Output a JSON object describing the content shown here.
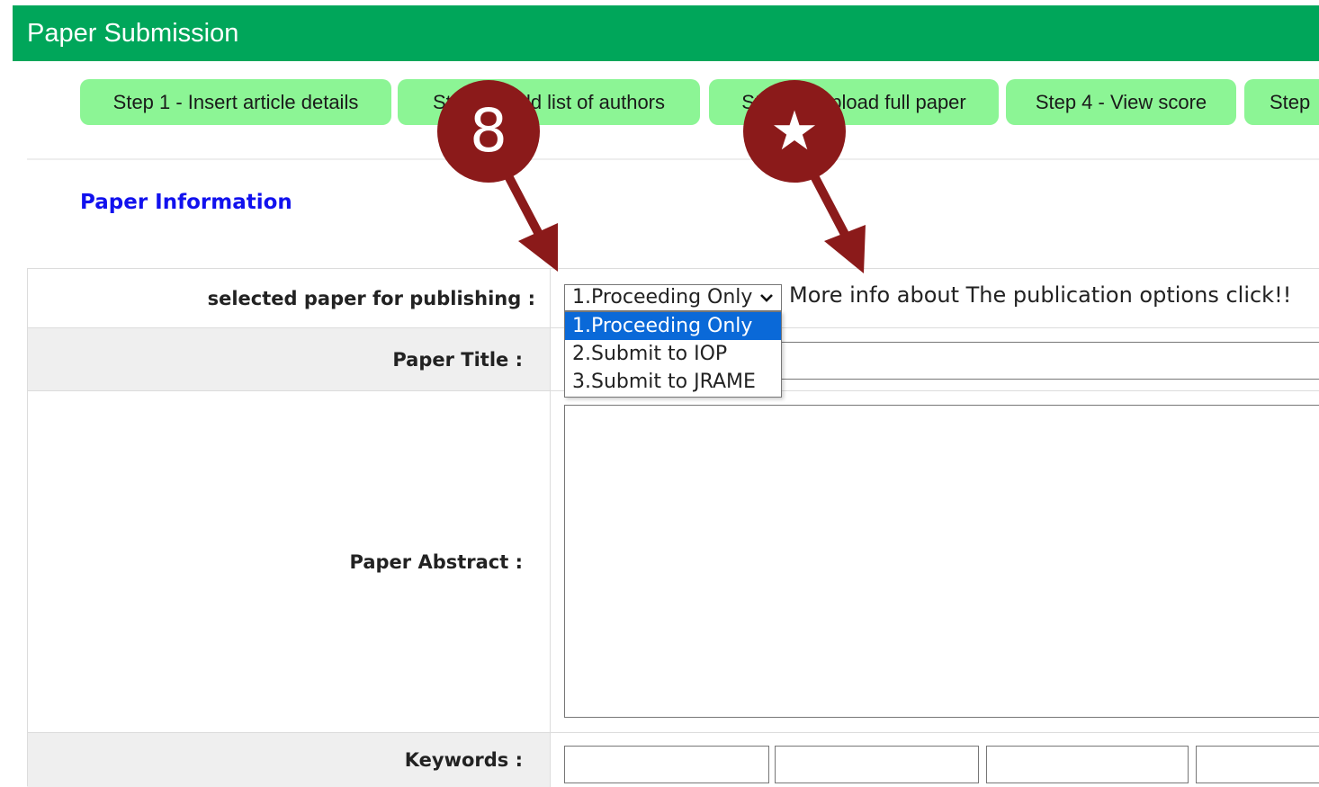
{
  "header": {
    "title": "Paper Submission"
  },
  "steps": [
    {
      "label": "Step 1 - Insert article details"
    },
    {
      "label": "Step 2 - Add list of authors"
    },
    {
      "label": "Step 3 - Upload full paper"
    },
    {
      "label": "Step 4 - View score"
    },
    {
      "label": "Step"
    }
  ],
  "section": {
    "title": "Paper Information"
  },
  "form": {
    "publishing_label": "selected paper for publishing :",
    "publishing_selected": "1.Proceeding Only",
    "publishing_options": [
      "1.Proceeding Only",
      "2.Submit to IOP",
      "3.Submit to JRAME"
    ],
    "more_info": "More info about The publication options click!!",
    "title_label": "Paper Title :",
    "title_value": "",
    "abstract_label": "Paper Abstract :",
    "abstract_value": "",
    "keywords_label": "Keywords :"
  },
  "annotations": {
    "badge_number": "8",
    "badge_star": "★",
    "color": "#8b1a1a"
  },
  "colors": {
    "header_bg": "#00a65a",
    "tab_bg": "#8cf595",
    "section_title": "#1111ee",
    "selected_option": "#0a69d8"
  }
}
